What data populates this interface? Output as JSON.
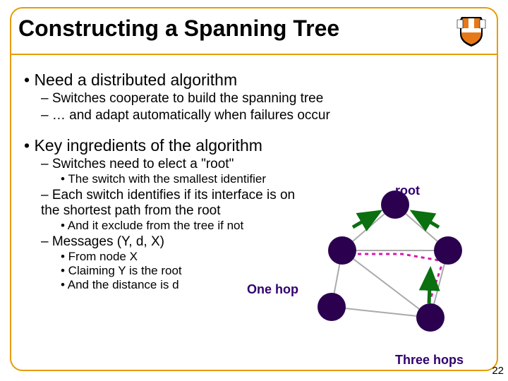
{
  "title": "Constructing a Spanning Tree",
  "bullets": {
    "b1": "• Need a distributed algorithm",
    "b1a": "– Switches cooperate to build the spanning tree",
    "b1b": "– … and adapt automatically when failures occur",
    "b2": "• Key ingredients of the algorithm",
    "b2a": "– Switches need to elect a \"root\"",
    "b2a1": "• The switch with the smallest identifier",
    "b2b": "– Each switch identifies if its interface is on the shortest path from the root",
    "b2b1": "• And it exclude from the tree if not",
    "b2c": "– Messages (Y, d, X)",
    "b2c1": "• From node X",
    "b2c2": "• Claiming Y is the root",
    "b2c3": "• And the distance is d"
  },
  "labels": {
    "root": "root",
    "one_hop": "One hop",
    "three_hops": "Three hops"
  },
  "page_number": "22",
  "colors": {
    "purple": "#31006f",
    "orange": "#e69c00"
  }
}
